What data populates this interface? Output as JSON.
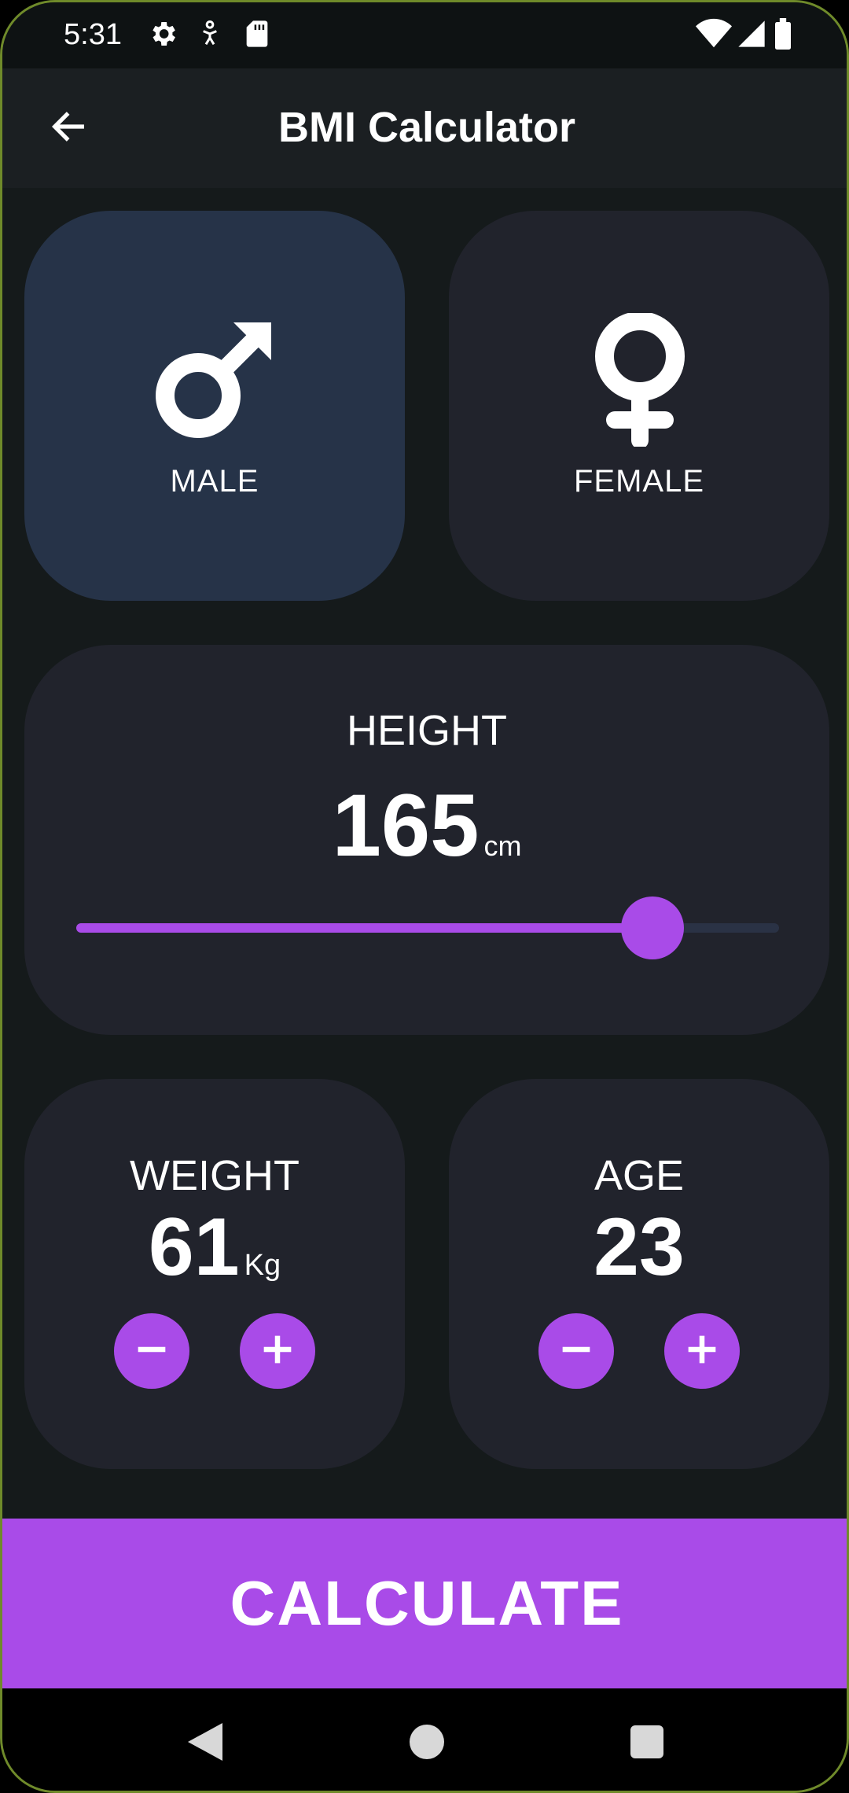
{
  "status_bar": {
    "time": "5:31",
    "icons": [
      "gear-icon",
      "accessibility-icon",
      "sd-card-icon"
    ],
    "right_icons": [
      "wifi-icon",
      "signal-icon",
      "battery-icon"
    ]
  },
  "app_bar": {
    "title": "BMI Calculator",
    "back_icon": "arrow-left-icon"
  },
  "gender": {
    "male_label": "MALE",
    "female_label": "FEMALE",
    "selected": "male"
  },
  "height": {
    "label": "HEIGHT",
    "value": "165",
    "unit": "cm",
    "slider_fraction": 0.82
  },
  "weight": {
    "label": "WEIGHT",
    "value": "61",
    "unit": "Kg"
  },
  "age": {
    "label": "AGE",
    "value": "23"
  },
  "calculate_label": "CALCULATE",
  "colors": {
    "accent": "#a94be8",
    "background": "#151a1b",
    "card": "#21232c",
    "card_selected": "#263348"
  }
}
